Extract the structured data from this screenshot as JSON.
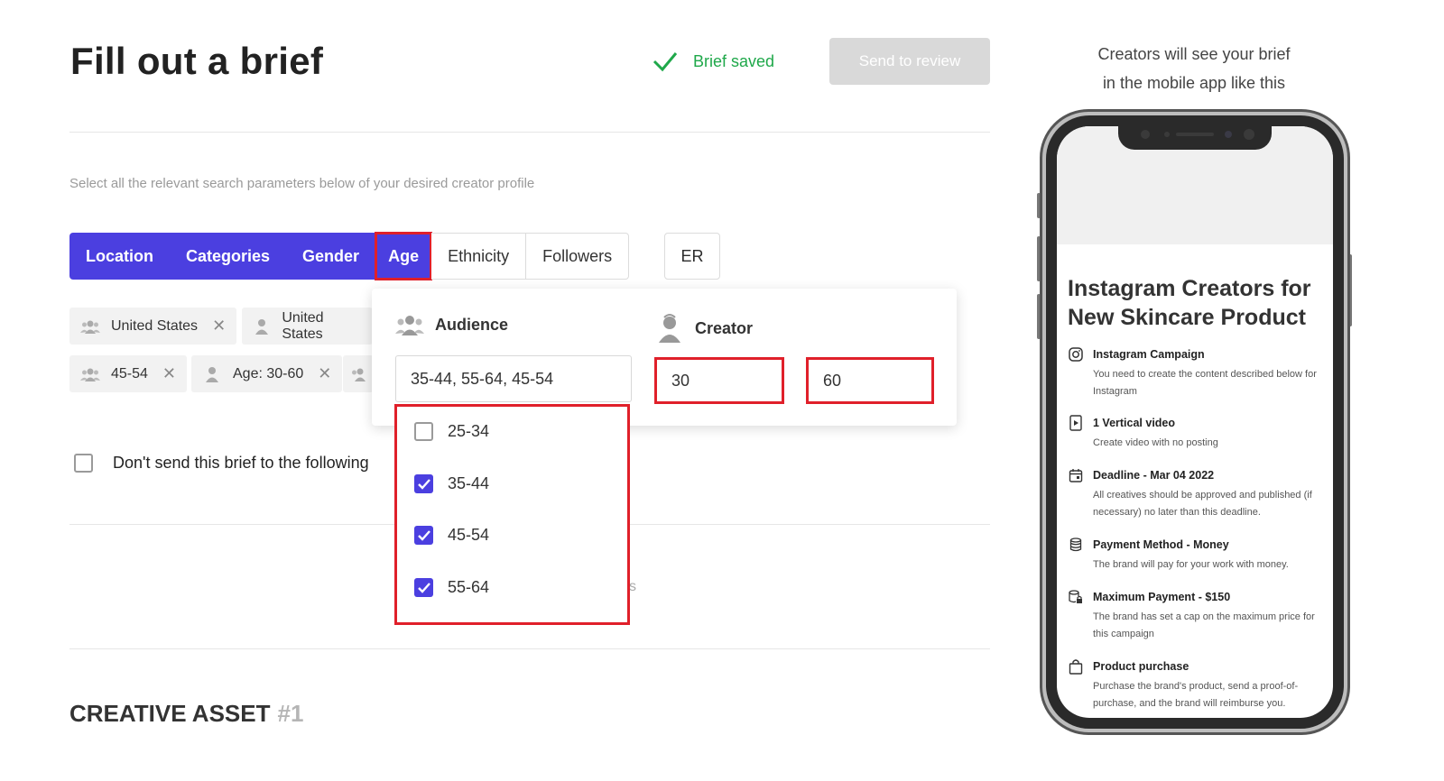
{
  "header": {
    "title": "Fill out a brief",
    "saved_status": "Brief saved",
    "send_button": "Send to review"
  },
  "hint": "Select all the relevant search parameters below of your desired creator profile",
  "tabs": [
    {
      "label": "Location",
      "active": true
    },
    {
      "label": "Categories",
      "active": true
    },
    {
      "label": "Gender",
      "active": true
    },
    {
      "label": "Age",
      "active": true,
      "highlighted": true
    },
    {
      "label": "Ethnicity",
      "active": false
    },
    {
      "label": "Followers",
      "active": false
    },
    {
      "label": "ER",
      "active": false
    }
  ],
  "chips": [
    {
      "icon": "audience-icon",
      "label": "United States"
    },
    {
      "icon": "creator-icon",
      "label": "United States"
    },
    {
      "icon": "audience-icon",
      "label": "45-54"
    },
    {
      "icon": "creator-icon",
      "label": "Age: 30-60"
    }
  ],
  "exclude_checkbox": {
    "label": "Don't send this brief to the following",
    "checked": false
  },
  "age_popover": {
    "audience_label": "Audience",
    "audience_value": "35-44, 55-64, 45-54",
    "creator_label": "Creator",
    "creator_min": "30",
    "creator_max": "60",
    "options": [
      {
        "label": "25-34",
        "checked": false
      },
      {
        "label": "35-44",
        "checked": true
      },
      {
        "label": "45-54",
        "checked": true
      },
      {
        "label": "55-64",
        "checked": true
      }
    ]
  },
  "stray_text": "s",
  "creative_asset": {
    "label": "CREATIVE ASSET",
    "number": "#1"
  },
  "preview": {
    "note_line1": "Creators will see your brief",
    "note_line2": "in the mobile app like this",
    "title": "Instagram Creators for New Skincare Product",
    "items": [
      {
        "icon": "instagram-icon",
        "title": "Instagram Campaign",
        "desc": "You need to create the content described below for Instagram"
      },
      {
        "icon": "video-icon",
        "title": "1 Vertical video",
        "desc": "Create video with no posting"
      },
      {
        "icon": "calendar-icon",
        "title": "Deadline - Mar 04 2022",
        "desc": "All creatives should be approved and published (if necessary) no later than this deadline."
      },
      {
        "icon": "coins-icon",
        "title": "Payment Method - Money",
        "desc": "The brand will pay for your work with money."
      },
      {
        "icon": "coins-lock-icon",
        "title": "Maximum Payment - $150",
        "desc": "The brand has set a cap on the maximum price for this campaign"
      },
      {
        "icon": "bag-icon",
        "title": "Product purchase",
        "desc": "Purchase the brand's product, send a proof-of-purchase, and the brand will reimburse you."
      }
    ]
  },
  "colors": {
    "accent": "#4b3fe0",
    "highlight": "#e0202a",
    "success": "#1fa84a"
  }
}
